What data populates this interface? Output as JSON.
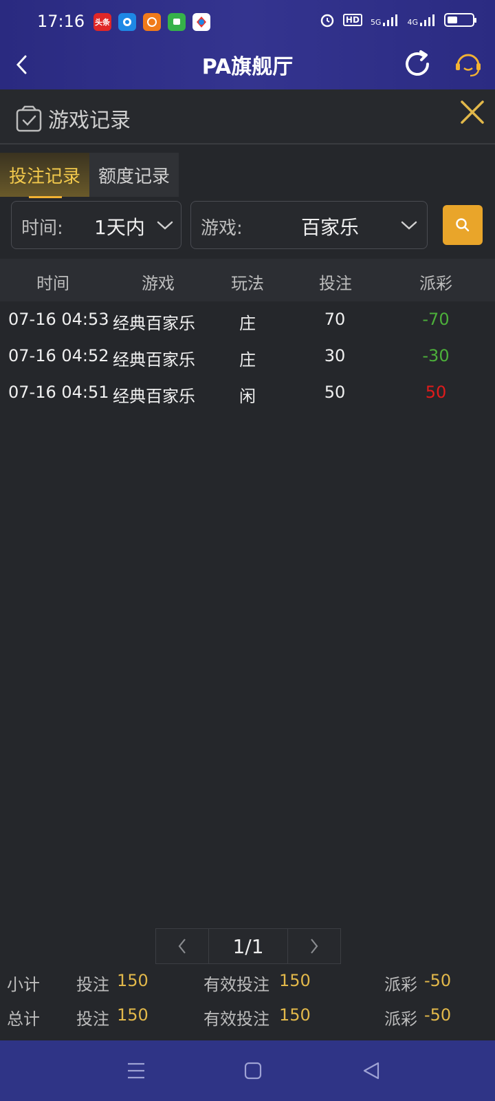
{
  "status_bar": {
    "time": "17:16",
    "app_icons": [
      {
        "name": "toutiao-app-icon",
        "label": "头条",
        "color": "#e02727"
      },
      {
        "name": "app2-icon",
        "label": "",
        "color": "#1e88e5"
      },
      {
        "name": "app3-icon",
        "label": "",
        "color": "#f07a1a"
      },
      {
        "name": "message-app-icon",
        "label": "",
        "color": "#36b24a"
      },
      {
        "name": "app5-icon",
        "label": "",
        "color": "#ffffff"
      }
    ],
    "hd": "HD",
    "signal_5g": "5G",
    "signal_4g": "4G"
  },
  "header": {
    "title": "PA旗舰厅"
  },
  "panel": {
    "title": "游戏记录"
  },
  "tabs": [
    {
      "label": "投注记录",
      "active": true
    },
    {
      "label": "额度记录",
      "active": false
    }
  ],
  "filters": {
    "time_label": "时间:",
    "time_value": "1天内",
    "game_label": "游戏:",
    "game_value": "百家乐"
  },
  "table": {
    "headers": [
      "时间",
      "游戏",
      "玩法",
      "投注",
      "派彩"
    ],
    "rows": [
      {
        "time": "07-16 04:53",
        "game": "经典百家乐",
        "play": "庄",
        "bet": "70",
        "payout": "-70"
      },
      {
        "time": "07-16 04:52",
        "game": "经典百家乐",
        "play": "庄",
        "bet": "30",
        "payout": "-30"
      },
      {
        "time": "07-16 04:51",
        "game": "经典百家乐",
        "play": "闲",
        "bet": "50",
        "payout": "50"
      }
    ]
  },
  "pagination": {
    "page": "1/1"
  },
  "summary": {
    "subtotal": {
      "label": "小计",
      "bet_label": "投注",
      "bet": "150",
      "valid_label": "有效投注",
      "valid": "150",
      "payout_label": "派彩",
      "payout": "-50"
    },
    "total": {
      "label": "总计",
      "bet_label": "投注",
      "bet": "150",
      "valid_label": "有效投注",
      "valid": "150",
      "payout_label": "派彩",
      "payout": "-50"
    }
  },
  "colors": {
    "accent": "#f2b233",
    "header_bg": "#2f3088",
    "negative": "#4caf3a",
    "positive": "#e01b1b"
  }
}
